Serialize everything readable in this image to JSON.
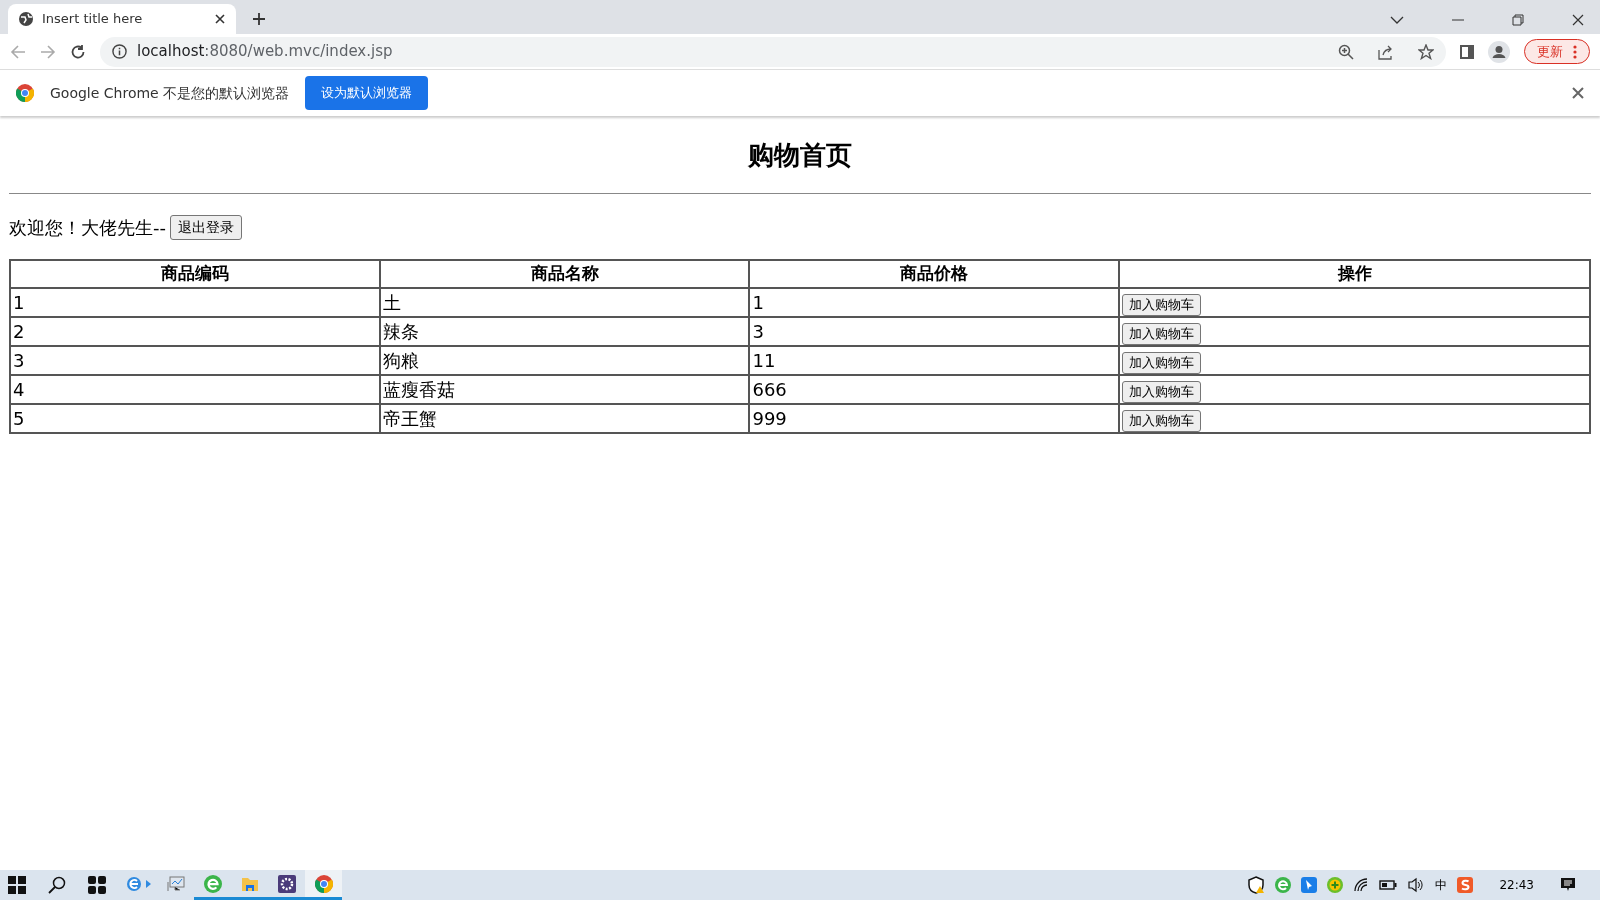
{
  "browser": {
    "tab_title": "Insert title here",
    "url_host": "localhost",
    "url_rest": ":8080/web.mvc/index.jsp",
    "update_button": "更新"
  },
  "infobar": {
    "message": "Google Chrome 不是您的默认浏览器",
    "button": "设为默认浏览器"
  },
  "page": {
    "heading": "购物首页",
    "welcome": "欢迎您！大佬先生--",
    "logout_button": "退出登录",
    "table": {
      "columns": [
        "商品编码",
        "商品名称",
        "商品价格",
        "操作"
      ],
      "rows": [
        {
          "code": "1",
          "name": "土",
          "price": "1",
          "action": "加入购物车"
        },
        {
          "code": "2",
          "name": "辣条",
          "price": "3",
          "action": "加入购物车"
        },
        {
          "code": "3",
          "name": "狗粮",
          "price": "11",
          "action": "加入购物车"
        },
        {
          "code": "4",
          "name": "蓝瘦香菇",
          "price": "666",
          "action": "加入购物车"
        },
        {
          "code": "5",
          "name": "帝王蟹",
          "price": "999",
          "action": "加入购物车"
        }
      ]
    }
  },
  "taskbar": {
    "apps": [
      {
        "kind": "ie",
        "running": false,
        "selected": false
      },
      {
        "kind": "monitor",
        "running": false,
        "selected": false
      },
      {
        "kind": "browser-e",
        "running": true,
        "selected": false
      },
      {
        "kind": "folder",
        "running": true,
        "selected": false
      },
      {
        "kind": "gear",
        "running": true,
        "selected": false
      },
      {
        "kind": "chrome",
        "running": true,
        "selected": true
      }
    ],
    "input_method": "中",
    "clock": "22:43"
  }
}
